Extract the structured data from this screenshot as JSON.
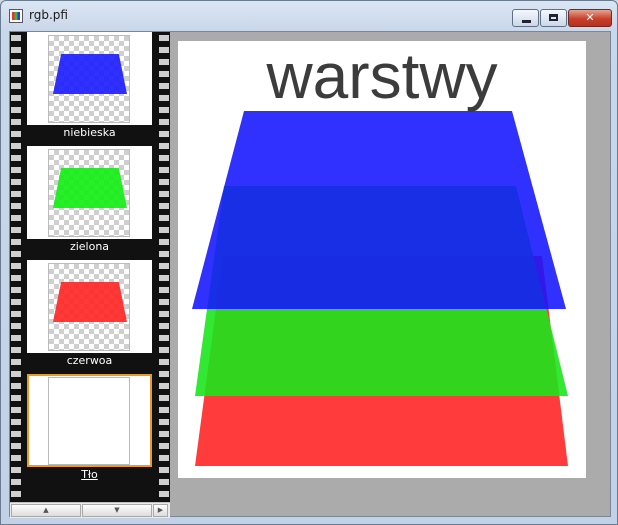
{
  "window": {
    "title": "rgb.pfi"
  },
  "layers": [
    {
      "name": "niebieska",
      "color": "#1a1aff",
      "selected": false
    },
    {
      "name": "zielona",
      "color": "#11ee11",
      "selected": false
    },
    {
      "name": "czerwoa",
      "color": "#ff2222",
      "selected": false
    },
    {
      "name": "Tło",
      "color": "#ffffff",
      "selected": true
    }
  ],
  "canvas": {
    "title": "warstwy",
    "colors": {
      "red": "#ff2a2a",
      "green": "#1ce61c",
      "blue": "#1414ff"
    }
  }
}
